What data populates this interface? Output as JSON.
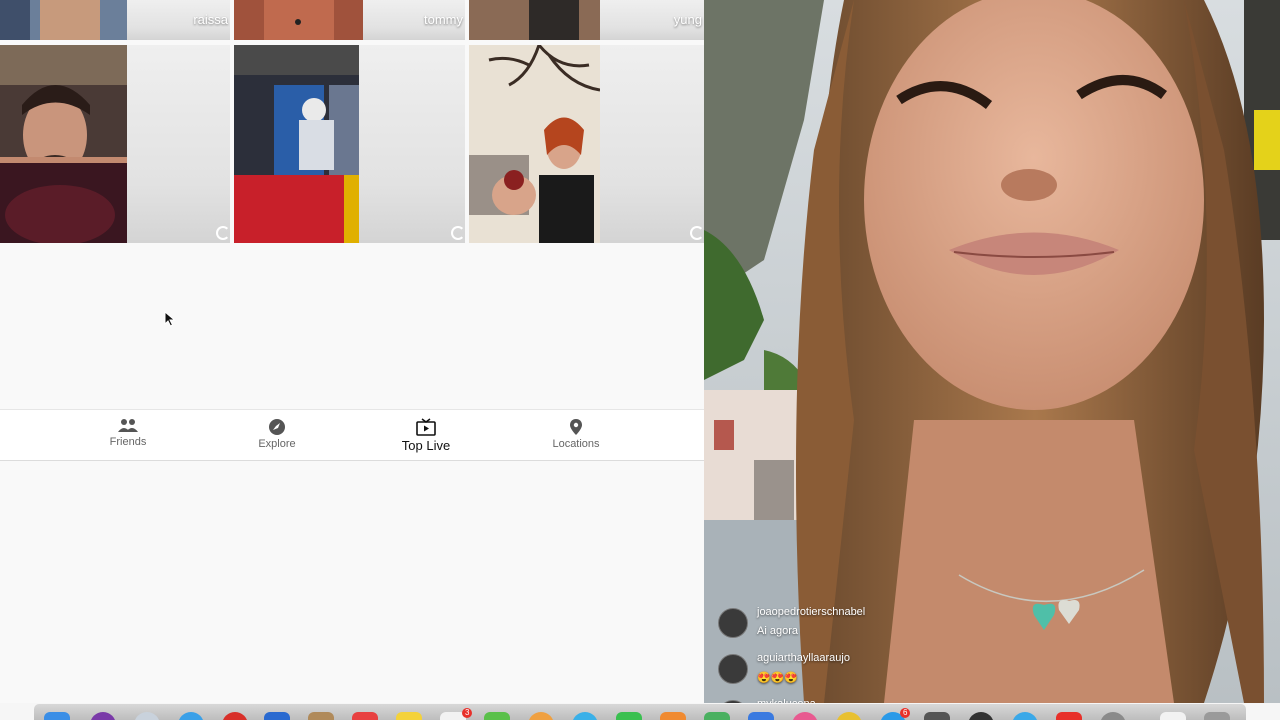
{
  "grid": {
    "top_row": [
      {
        "username": "raissa"
      },
      {
        "username": "tommy"
      },
      {
        "username": "yung"
      }
    ]
  },
  "bottom_nav": {
    "items": [
      {
        "label": "Friends",
        "icon": "people-icon"
      },
      {
        "label": "Explore",
        "icon": "compass-icon"
      },
      {
        "label": "Top Live",
        "icon": "tv-play-icon",
        "active": true
      },
      {
        "label": "Locations",
        "icon": "location-pin-icon"
      }
    ]
  },
  "live": {
    "comments": [
      {
        "user": "joaopedrotierschnabel",
        "text": "Ai agora"
      },
      {
        "user": "aguiarthayllaaraujo",
        "text": "😍😍😍"
      },
      {
        "user": "mykalucena",
        "text": ""
      }
    ]
  },
  "dock": {
    "badge_counts": [
      "3",
      "6"
    ]
  },
  "colors": {
    "active_nav": "#111111",
    "inactive_nav": "#666666",
    "thumb_red": "#c8202a"
  }
}
